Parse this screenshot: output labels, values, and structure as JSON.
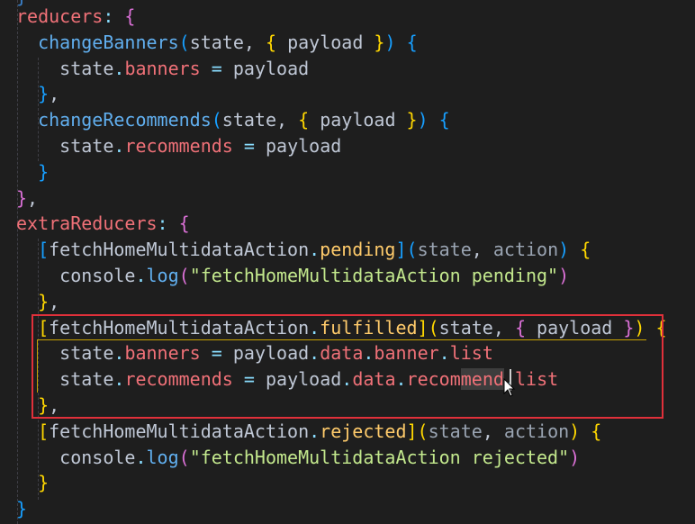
{
  "colors": {
    "background": "#1e1e1e",
    "property": "#f07178",
    "function": "#61afef",
    "param": "#bfc7d5",
    "param_dim": "#9aa4b2",
    "string": "#c3e88d",
    "operator": "#89ddff",
    "brace_l1": "#ffd700",
    "brace_l2": "#da70d6",
    "brace_l3": "#179fff",
    "highlight_border": "#e0303a"
  },
  "cursor": {
    "icon": "mouse-pointer-icon"
  },
  "top_fragment": "}",
  "code_lines": [
    [
      {
        "t": "reducers",
        "c": "#f07178"
      },
      {
        "t": ": ",
        "c": "#89ddff"
      },
      {
        "t": "{",
        "c": "#da70d6"
      }
    ],
    [
      {
        "t": "  "
      },
      {
        "t": "changeBanners",
        "c": "#61afef"
      },
      {
        "t": "(",
        "c": "#179fff"
      },
      {
        "t": "state",
        "c": "#bfc7d5"
      },
      {
        "t": ", ",
        "c": "#bfc7d5"
      },
      {
        "t": "{",
        "c": "#ffd700"
      },
      {
        "t": " payload ",
        "c": "#bfc7d5"
      },
      {
        "t": "}",
        "c": "#ffd700"
      },
      {
        "t": ")",
        "c": "#179fff"
      },
      {
        "t": " "
      },
      {
        "t": "{",
        "c": "#179fff"
      }
    ],
    [
      {
        "t": "    "
      },
      {
        "t": "state",
        "c": "#bfc7d5"
      },
      {
        "t": ".",
        "c": "#89ddff"
      },
      {
        "t": "banners",
        "c": "#f07178"
      },
      {
        "t": " = ",
        "c": "#89ddff"
      },
      {
        "t": "payload",
        "c": "#bfc7d5"
      }
    ],
    [
      {
        "t": "  "
      },
      {
        "t": "}",
        "c": "#179fff"
      },
      {
        "t": ",",
        "c": "#bfc7d5"
      }
    ],
    [
      {
        "t": "  "
      },
      {
        "t": "changeRecommends",
        "c": "#61afef"
      },
      {
        "t": "(",
        "c": "#179fff"
      },
      {
        "t": "state",
        "c": "#bfc7d5"
      },
      {
        "t": ", ",
        "c": "#bfc7d5"
      },
      {
        "t": "{",
        "c": "#ffd700"
      },
      {
        "t": " payload ",
        "c": "#bfc7d5"
      },
      {
        "t": "}",
        "c": "#ffd700"
      },
      {
        "t": ")",
        "c": "#179fff"
      },
      {
        "t": " "
      },
      {
        "t": "{",
        "c": "#179fff"
      }
    ],
    [
      {
        "t": "    "
      },
      {
        "t": "state",
        "c": "#bfc7d5"
      },
      {
        "t": ".",
        "c": "#89ddff"
      },
      {
        "t": "recommends",
        "c": "#f07178"
      },
      {
        "t": " = ",
        "c": "#89ddff"
      },
      {
        "t": "payload",
        "c": "#bfc7d5"
      }
    ],
    [
      {
        "t": "  "
      },
      {
        "t": "}",
        "c": "#179fff"
      }
    ],
    [
      {
        "t": "}",
        "c": "#da70d6"
      },
      {
        "t": ",",
        "c": "#bfc7d5"
      }
    ],
    [
      {
        "t": "extraReducers",
        "c": "#f07178"
      },
      {
        "t": ": ",
        "c": "#89ddff"
      },
      {
        "t": "{",
        "c": "#da70d6"
      }
    ],
    [
      {
        "t": "  "
      },
      {
        "t": "[",
        "c": "#179fff"
      },
      {
        "t": "fetchHomeMultidataAction",
        "c": "#bfc7d5"
      },
      {
        "t": ".",
        "c": "#89ddff"
      },
      {
        "t": "pending",
        "c": "#ffcb6b"
      },
      {
        "t": "]",
        "c": "#179fff"
      },
      {
        "t": "(",
        "c": "#179fff"
      },
      {
        "t": "state",
        "c": "#9aa4b2"
      },
      {
        "t": ", ",
        "c": "#bfc7d5"
      },
      {
        "t": "action",
        "c": "#9aa4b2"
      },
      {
        "t": ")",
        "c": "#179fff"
      },
      {
        "t": " "
      },
      {
        "t": "{",
        "c": "#ffd700"
      }
    ],
    [
      {
        "t": "    "
      },
      {
        "t": "console",
        "c": "#bfc7d5"
      },
      {
        "t": ".",
        "c": "#89ddff"
      },
      {
        "t": "log",
        "c": "#61afef"
      },
      {
        "t": "(",
        "c": "#da70d6"
      },
      {
        "t": "\"fetchHomeMultidataAction pending\"",
        "c": "#c3e88d"
      },
      {
        "t": ")",
        "c": "#da70d6"
      }
    ],
    [
      {
        "t": "  "
      },
      {
        "t": "}",
        "c": "#ffd700"
      },
      {
        "t": ",",
        "c": "#bfc7d5"
      }
    ],
    [
      {
        "t": "  "
      },
      {
        "t": "[",
        "c": "#ffd700"
      },
      {
        "t": "fetchHomeMultidataAction",
        "c": "#bfc7d5"
      },
      {
        "t": ".",
        "c": "#89ddff"
      },
      {
        "t": "fulfilled",
        "c": "#ffcb6b"
      },
      {
        "t": "]",
        "c": "#ffd700"
      },
      {
        "t": "(",
        "c": "#ffd700"
      },
      {
        "t": "state",
        "c": "#bfc7d5"
      },
      {
        "t": ", ",
        "c": "#bfc7d5"
      },
      {
        "t": "{",
        "c": "#da70d6"
      },
      {
        "t": " payload ",
        "c": "#bfc7d5"
      },
      {
        "t": "}",
        "c": "#da70d6"
      },
      {
        "t": ")",
        "c": "#ffd700"
      },
      {
        "t": " "
      },
      {
        "t": "{",
        "c": "#ffd700"
      }
    ],
    [
      {
        "t": "    "
      },
      {
        "t": "state",
        "c": "#bfc7d5"
      },
      {
        "t": ".",
        "c": "#89ddff"
      },
      {
        "t": "banners",
        "c": "#f07178"
      },
      {
        "t": " = ",
        "c": "#89ddff"
      },
      {
        "t": "payload",
        "c": "#bfc7d5"
      },
      {
        "t": ".",
        "c": "#89ddff"
      },
      {
        "t": "data",
        "c": "#f07178"
      },
      {
        "t": ".",
        "c": "#89ddff"
      },
      {
        "t": "banner",
        "c": "#f07178"
      },
      {
        "t": ".",
        "c": "#89ddff"
      },
      {
        "t": "list",
        "c": "#f07178"
      }
    ],
    [
      {
        "t": "    "
      },
      {
        "t": "state",
        "c": "#bfc7d5"
      },
      {
        "t": ".",
        "c": "#89ddff"
      },
      {
        "t": "recommends",
        "c": "#f07178"
      },
      {
        "t": " = ",
        "c": "#89ddff"
      },
      {
        "t": "payload",
        "c": "#bfc7d5"
      },
      {
        "t": ".",
        "c": "#89ddff"
      },
      {
        "t": "data",
        "c": "#f07178"
      },
      {
        "t": ".",
        "c": "#89ddff"
      },
      {
        "t": "recom",
        "c": "#f07178"
      },
      {
        "t": "mend",
        "c": "#f07178",
        "sel": true
      },
      {
        "t": ".",
        "c": "#89ddff"
      },
      {
        "t": "list",
        "c": "#f07178"
      }
    ],
    [
      {
        "t": "  "
      },
      {
        "t": "}",
        "c": "#ffd700"
      },
      {
        "t": ",",
        "c": "#bfc7d5"
      }
    ],
    [
      {
        "t": "  "
      },
      {
        "t": "[",
        "c": "#ffd700"
      },
      {
        "t": "fetchHomeMultidataAction",
        "c": "#bfc7d5"
      },
      {
        "t": ".",
        "c": "#89ddff"
      },
      {
        "t": "rejected",
        "c": "#ffcb6b"
      },
      {
        "t": "]",
        "c": "#ffd700"
      },
      {
        "t": "(",
        "c": "#ffd700"
      },
      {
        "t": "state",
        "c": "#9aa4b2"
      },
      {
        "t": ", ",
        "c": "#bfc7d5"
      },
      {
        "t": "action",
        "c": "#9aa4b2"
      },
      {
        "t": ")",
        "c": "#ffd700"
      },
      {
        "t": " "
      },
      {
        "t": "{",
        "c": "#ffd700"
      }
    ],
    [
      {
        "t": "    "
      },
      {
        "t": "console",
        "c": "#bfc7d5"
      },
      {
        "t": ".",
        "c": "#89ddff"
      },
      {
        "t": "log",
        "c": "#61afef"
      },
      {
        "t": "(",
        "c": "#da70d6"
      },
      {
        "t": "\"fetchHomeMultidataAction rejected\"",
        "c": "#c3e88d"
      },
      {
        "t": ")",
        "c": "#da70d6"
      }
    ],
    [
      {
        "t": "  "
      },
      {
        "t": "}",
        "c": "#ffd700"
      }
    ],
    [
      {
        "t": "}",
        "c": "#179fff"
      }
    ]
  ]
}
